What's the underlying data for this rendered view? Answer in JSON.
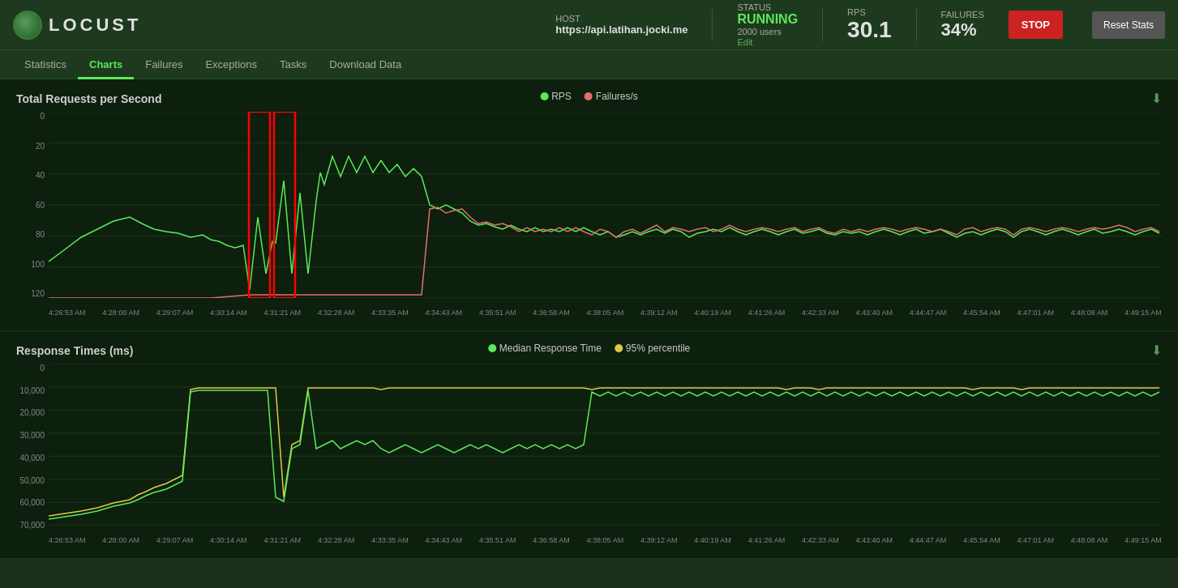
{
  "header": {
    "logo_text": "LOCUST",
    "host_label": "HOST",
    "host_value": "https://api.latihan.jocki.me",
    "status_label": "STATUS",
    "status_value": "RUNNING",
    "users_value": "2000 users",
    "edit_label": "Edit",
    "rps_label": "RPS",
    "rps_value": "30.1",
    "failures_label": "FAILURES",
    "failures_value": "34%",
    "stop_label": "STOP",
    "reset_label": "Reset Stats"
  },
  "nav": {
    "items": [
      {
        "label": "Statistics",
        "active": false
      },
      {
        "label": "Charts",
        "active": true
      },
      {
        "label": "Failures",
        "active": false
      },
      {
        "label": "Exceptions",
        "active": false
      },
      {
        "label": "Tasks",
        "active": false
      },
      {
        "label": "Download Data",
        "active": false
      }
    ]
  },
  "chart1": {
    "title": "Total Requests per Second",
    "legend": [
      {
        "label": "RPS",
        "color": "#5aea5a"
      },
      {
        "label": "Failures/s",
        "color": "#e07070"
      }
    ],
    "y_labels": [
      "0",
      "20",
      "40",
      "60",
      "80",
      "100",
      "120"
    ],
    "x_labels": [
      "4:26:53 AM",
      "4:28:00 AM",
      "4:29:07 AM",
      "4:30:14 AM",
      "4:31:21 AM",
      "4:32:28 AM",
      "4:33:35 AM",
      "4:34:43 AM",
      "4:35:51 AM",
      "4:36:58 AM",
      "4:38:05 AM",
      "4:39:12 AM",
      "4:40:19 AM",
      "4:41:26 AM",
      "4:42:33 AM",
      "4:43:40 AM",
      "4:44:47 AM",
      "4:45:54 AM",
      "4:47:01 AM",
      "4:48:08 AM",
      "4:49:15 AM"
    ]
  },
  "chart2": {
    "title": "Response Times (ms)",
    "legend": [
      {
        "label": "Median Response Time",
        "color": "#5aea5a"
      },
      {
        "label": "95% percentile",
        "color": "#e0c84a"
      }
    ],
    "y_labels": [
      "0",
      "10,000",
      "20,000",
      "30,000",
      "40,000",
      "50,000",
      "60,000",
      "70,000"
    ],
    "x_labels": [
      "4:26:53 AM",
      "4:28:00 AM",
      "4:29:07 AM",
      "4:30:14 AM",
      "4:31:21 AM",
      "4:32:28 AM",
      "4:33:35 AM",
      "4:34:43 AM",
      "4:35:51 AM",
      "4:36:58 AM",
      "4:38:05 AM",
      "4:39:12 AM",
      "4:40:19 AM",
      "4:41:26 AM",
      "4:42:33 AM",
      "4:43:40 AM",
      "4:44:47 AM",
      "4:45:54 AM",
      "4:47:01 AM",
      "4:48:08 AM",
      "4:49:15 AM"
    ]
  }
}
